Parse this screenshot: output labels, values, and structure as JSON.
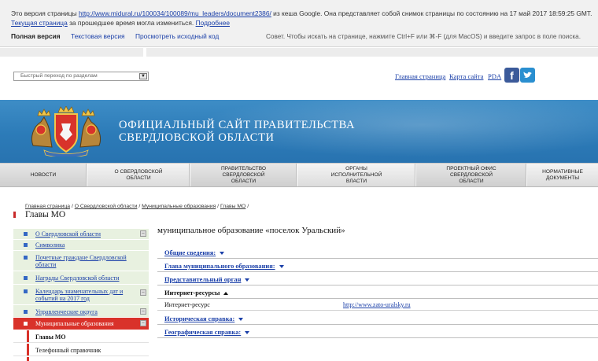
{
  "cache": {
    "line1_prefix": "Это версия страницы",
    "url": "http://www.midural.ru/100034/100089/mu_leaders/document2386/",
    "line1_suffix": "из кеша Google. Она представляет собой снимок страницы по состоянию на 17 май 2017 18:59:25 GMT.",
    "current_page_link": "Текущая страница",
    "line2_middle": "за прошедшее время могла измениться.",
    "more_link": "Подробнее",
    "full_version": "Полная версия",
    "text_version": "Текстовая версия",
    "view_source": "Просмотреть исходный код",
    "tip": "Совет. Чтобы искать на странице, нажмите Ctrl+F или ⌘-F (для MacOS) и введите запрос в поле поиска."
  },
  "top": {
    "quick_nav_placeholder": "Быстрый переход по разделам",
    "links": [
      "Главная страница",
      "Карта сайта",
      "PDA"
    ],
    "social": [
      "facebook-icon",
      "twitter-icon"
    ]
  },
  "banner": {
    "title_line1": "ОФИЦИАЛЬНЫЙ САЙТ ПРАВИТЕЛЬСТВА",
    "title_line2": "СВЕРДЛОВСКОЙ ОБЛАСТИ"
  },
  "menu": [
    "НОВОСТИ",
    "О СВЕРДЛОВСКОЙ ОБЛАСТИ",
    "ПРАВИТЕЛЬСТВО СВЕРДЛОВСКОЙ ОБЛАСТИ",
    "ОРГАНЫ ИСПОЛНИТЕЛЬНОЙ ВЛАСТИ",
    "ПРОЕКТНЫЙ ОФИС СВЕРДЛОВСКОЙ ОБЛАСТИ",
    "НОРМАТИВНЫЕ ДОКУМЕНТЫ"
  ],
  "breadcrumb": [
    "Главная страница",
    "О Свердловской области",
    "Муниципальные образования",
    "Главы МО"
  ],
  "breadcrumb_sep": "/",
  "page_title": "Главы МО",
  "sidebar": [
    "О Свердловской области",
    "Символика",
    "Почетные граждане Свердловской области",
    "Награды Свердловской области",
    "Календарь знаменательных дат и событий на 2017 год",
    "Управленческие округа",
    "Муниципальные образования",
    "Главы МО",
    "Телефонный справочник"
  ],
  "main": {
    "title": "муниципальное образование «поселок Уральский»",
    "sections": [
      "Общие сведения:",
      "Глава муниципального образования:",
      "Представительный орган",
      "Интернет-ресурсы",
      "Историческая справка:",
      "Географическая справка:"
    ],
    "internet_row": {
      "label": "Интернет-ресурс",
      "value": "http://www.zato-uralsky.ru"
    }
  }
}
